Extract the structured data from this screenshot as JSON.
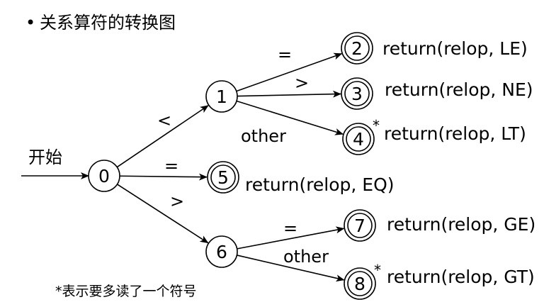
{
  "title": "关系算符的转换图",
  "bullet": "•",
  "start_label": "开始",
  "footnote": "*表示要多读了一个符号",
  "colors": {
    "ink": "#000000",
    "background": "#ffffff"
  },
  "states": [
    {
      "id": "0",
      "label": "0",
      "accepting": false
    },
    {
      "id": "1",
      "label": "1",
      "accepting": false
    },
    {
      "id": "2",
      "label": "2",
      "accepting": true,
      "action": "return(relop, LE)",
      "retract": false
    },
    {
      "id": "3",
      "label": "3",
      "accepting": true,
      "action": "return(relop, NE)",
      "retract": false
    },
    {
      "id": "4",
      "label": "4",
      "accepting": true,
      "action": "return(relop, LT)",
      "retract": true
    },
    {
      "id": "5",
      "label": "5",
      "accepting": true,
      "action": "return(relop, EQ)",
      "retract": false
    },
    {
      "id": "6",
      "label": "6",
      "accepting": false
    },
    {
      "id": "7",
      "label": "7",
      "accepting": true,
      "action": "return(relop, GE)",
      "retract": false
    },
    {
      "id": "8",
      "label": "8",
      "accepting": true,
      "action": "return(relop, GT)",
      "retract": true
    }
  ],
  "transitions": [
    {
      "from": "0",
      "to": "1",
      "label": "<"
    },
    {
      "from": "0",
      "to": "5",
      "label": "="
    },
    {
      "from": "0",
      "to": "6",
      "label": ">"
    },
    {
      "from": "1",
      "to": "2",
      "label": "="
    },
    {
      "from": "1",
      "to": "3",
      "label": ">"
    },
    {
      "from": "1",
      "to": "4",
      "label": "other"
    },
    {
      "from": "6",
      "to": "7",
      "label": "="
    },
    {
      "from": "6",
      "to": "8",
      "label": "other"
    }
  ],
  "retract_mark": "*"
}
